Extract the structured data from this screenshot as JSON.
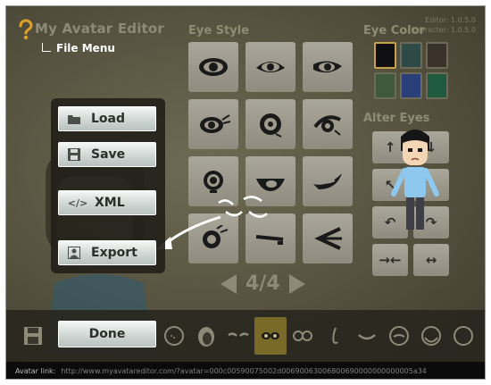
{
  "app": {
    "title": "My Avatar Editor",
    "file_menu": "File Menu"
  },
  "version": {
    "editor": "Editor: 1.0.5.0",
    "character": "Character: 1.0.5.0"
  },
  "sections": {
    "eye_style": "Eye Style",
    "eye_color": "Eye Color",
    "alter_eyes": "Alter Eyes"
  },
  "file_menu": {
    "load": {
      "label": "Load",
      "icon": "folder-icon"
    },
    "save": {
      "label": "Save",
      "icon": "floppy-disk-icon"
    },
    "xml": {
      "label": "XML",
      "icon": "code-icon",
      "icon_text": "</>"
    },
    "export": {
      "label": "Export",
      "icon": "portrait-icon"
    }
  },
  "eye_styles": [
    "eye-1",
    "eye-2",
    "eye-3",
    "eye-4",
    "eye-5",
    "eye-6",
    "eye-7",
    "eye-8",
    "eye-9",
    "eye-10",
    "eye-11",
    "eye-12"
  ],
  "pager": {
    "text": "4/4"
  },
  "eye_colors": [
    {
      "hex": "#0f0f14",
      "selected": true
    },
    {
      "hex": "#2d4a46",
      "selected": false
    },
    {
      "hex": "#3a322a",
      "selected": false
    },
    {
      "hex": "#3f5a3a",
      "selected": false
    },
    {
      "hex": "#2a3f7a",
      "selected": false
    },
    {
      "hex": "#1f5a3e",
      "selected": false
    }
  ],
  "alter_eyes": [
    {
      "symbol": "↑",
      "icon": "move-up-icon"
    },
    {
      "symbol": "↓",
      "icon": "move-down-icon"
    },
    {
      "symbol": "↖",
      "icon": "shrink-icon"
    },
    {
      "symbol": "↘",
      "icon": "grow-icon"
    },
    {
      "symbol": "↶",
      "icon": "rotate-left-icon"
    },
    {
      "symbol": "↷",
      "icon": "rotate-right-icon"
    },
    {
      "symbol": "→←",
      "icon": "closer-icon"
    },
    {
      "symbol": "↔",
      "icon": "farther-icon"
    }
  ],
  "done": {
    "label": "Done"
  },
  "status": {
    "label": "Avatar link:",
    "url": "http://www.myavatareditor.com/?avatar=000c00590075002d00690063006800690000000000005a34"
  },
  "colors": {
    "accent": "#c7a24a",
    "button_text": "#2b2f2c"
  }
}
